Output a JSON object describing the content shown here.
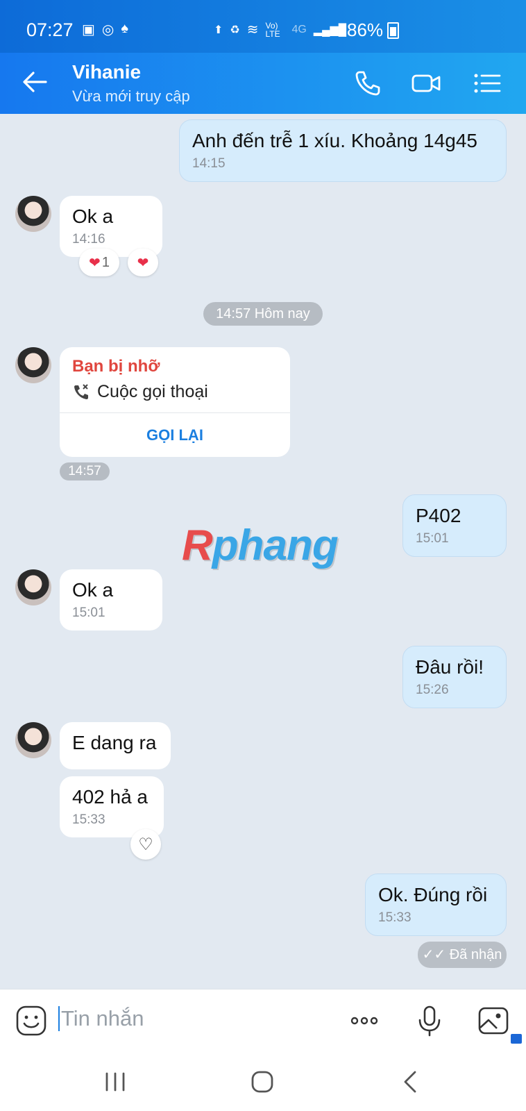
{
  "status_bar": {
    "time": "07:27",
    "network": "Vo) LTE",
    "network_type": "4G",
    "battery": "86%"
  },
  "header": {
    "name": "Vihanie",
    "status": "Vừa mới truy cập"
  },
  "messages": {
    "m1": {
      "text": "Anh đến trễ 1 xíu.  Khoảng 14g45",
      "time": "14:15"
    },
    "m2": {
      "text": "Ok a",
      "time": "14:16",
      "reaction_count": "1"
    },
    "divider": "14:57 Hôm nay",
    "missed_call": {
      "title": "Bạn bị nhỡ",
      "subtitle": "Cuộc gọi thoại",
      "action": "GỌI LẠI",
      "time": "14:57"
    },
    "m3": {
      "text": "P402",
      "time": "15:01"
    },
    "m4": {
      "text": "Ok a",
      "time": "15:01"
    },
    "m5": {
      "text": "Đâu rồi!",
      "time": "15:26"
    },
    "m6": {
      "text": "E dang ra"
    },
    "m7": {
      "text": "402 hả a",
      "time": "15:33"
    },
    "m8": {
      "text": "Ok. Đúng rồi",
      "time": "15:33"
    },
    "received": "Đã nhận"
  },
  "watermark": {
    "first": "R",
    "rest": "phang"
  },
  "input": {
    "placeholder": "Tin nhắn"
  },
  "colors": {
    "header": "#1678ef",
    "outgoing_bubble": "#d6ecfc",
    "missed_call": "#e0463e",
    "accent": "#1b7fe0"
  }
}
